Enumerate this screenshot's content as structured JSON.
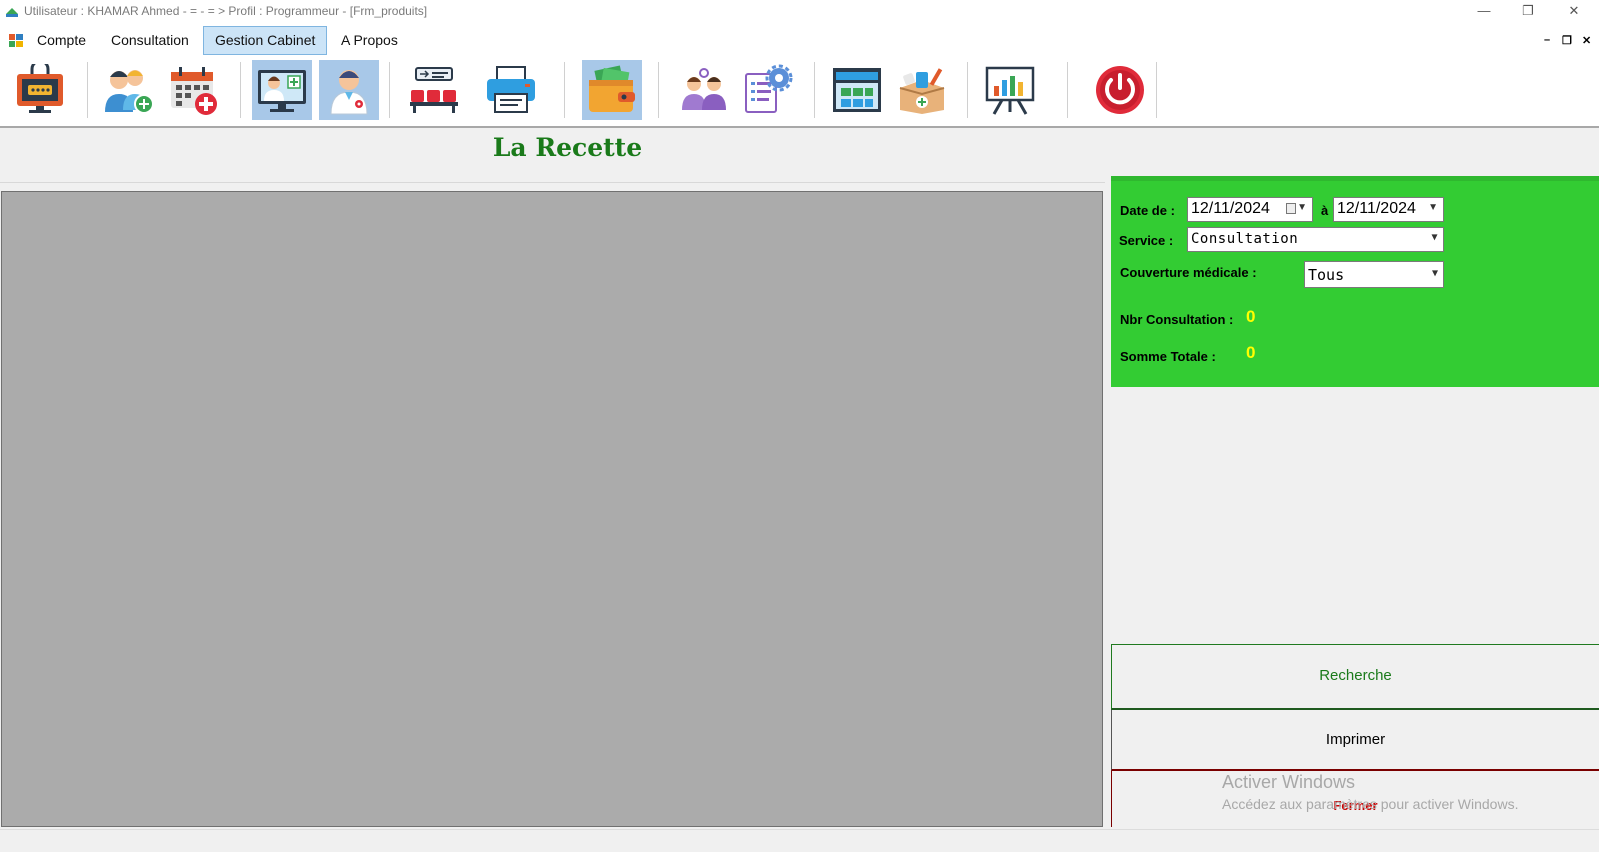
{
  "window": {
    "title": "Utilisateur : KHAMAR  Ahmed - = - = > Profil : Programmeur - [Frm_produits]",
    "minimize": "—",
    "maximize": "❐",
    "close": "✕"
  },
  "menu": {
    "items": [
      {
        "label": "Compte"
      },
      {
        "label": "Consultation"
      },
      {
        "label": "Gestion Cabinet"
      },
      {
        "label": "A Propos"
      }
    ],
    "mdi_minimize": "–",
    "mdi_restore": "❐",
    "mdi_close": "✕"
  },
  "toolbar": {
    "tools": [
      {
        "icon": "login-screen-icon"
      },
      {
        "icon": "add-patient-icon"
      },
      {
        "icon": "medical-calendar-icon"
      },
      {
        "icon": "doctor-computer-icon",
        "selected": true
      },
      {
        "icon": "doctor-icon",
        "selected": true
      },
      {
        "icon": "waiting-room-icon"
      },
      {
        "icon": "printer-icon"
      },
      {
        "icon": "wallet-icon",
        "selected": true
      },
      {
        "icon": "users-group-icon"
      },
      {
        "icon": "settings-document-icon"
      },
      {
        "icon": "pharmacy-store-icon"
      },
      {
        "icon": "medicine-box-icon"
      },
      {
        "icon": "statistics-board-icon"
      },
      {
        "icon": "power-icon"
      }
    ]
  },
  "form": {
    "title": "La Recette",
    "date_from_label": "Date de :",
    "date_from": "12/11/2024",
    "date_to_label": "à",
    "date_to": "12/11/2024",
    "service_label": "Service :",
    "service_value": "Consultation",
    "coverage_label": "Couverture médicale :",
    "coverage_value": "Tous",
    "nbr_label": "Nbr Consultation :",
    "nbr_value": "0",
    "total_label": "Somme Totale :",
    "total_value": "0"
  },
  "buttons": {
    "search": "Recherche",
    "print": "Imprimer",
    "close": "Fermer"
  },
  "watermark": {
    "line1": "Activer Windows",
    "line2": "Accédez aux paramètres pour activer Windows."
  },
  "colors": {
    "panel_green": "#33cc33",
    "title_green": "#1a7a1a",
    "value_yellow": "#ffff00",
    "grid_gray": "#ababab"
  }
}
